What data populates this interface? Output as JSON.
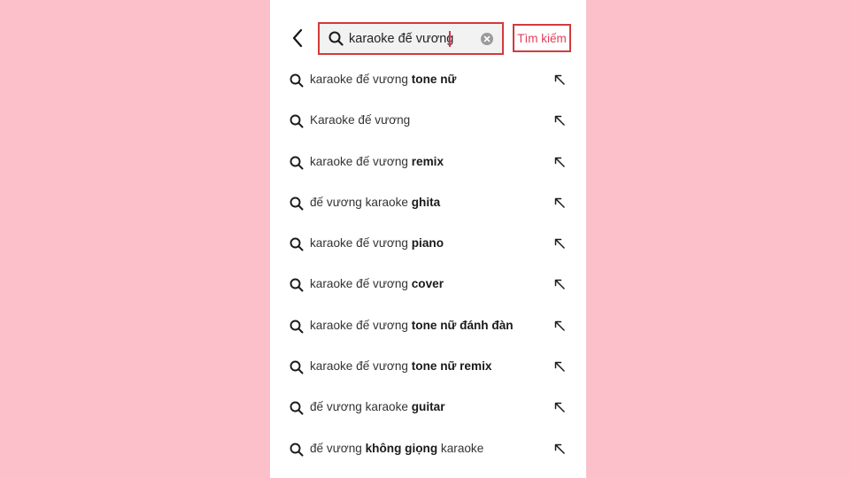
{
  "search": {
    "query": "karaoke đế vương",
    "action_label": "Tìm kiếm"
  },
  "suggestions": [
    {
      "parts": [
        {
          "text": "karaoke đế vương ",
          "bold": false
        },
        {
          "text": "tone nữ",
          "bold": true
        }
      ]
    },
    {
      "parts": [
        {
          "text": "Karaoke đế vương",
          "bold": false
        }
      ]
    },
    {
      "parts": [
        {
          "text": "karaoke đế vương ",
          "bold": false
        },
        {
          "text": "remix",
          "bold": true
        }
      ]
    },
    {
      "parts": [
        {
          "text": "đế vương karaoke ",
          "bold": false
        },
        {
          "text": "ghita",
          "bold": true
        }
      ]
    },
    {
      "parts": [
        {
          "text": "karaoke đế vương ",
          "bold": false
        },
        {
          "text": "piano",
          "bold": true
        }
      ]
    },
    {
      "parts": [
        {
          "text": "karaoke đế vương ",
          "bold": false
        },
        {
          "text": "cover",
          "bold": true
        }
      ]
    },
    {
      "parts": [
        {
          "text": "karaoke đế vương ",
          "bold": false
        },
        {
          "text": "tone nữ đánh đàn",
          "bold": true
        }
      ]
    },
    {
      "parts": [
        {
          "text": "karaoke đế vương ",
          "bold": false
        },
        {
          "text": "tone nữ remix",
          "bold": true
        }
      ]
    },
    {
      "parts": [
        {
          "text": "đế vương karaoke ",
          "bold": false
        },
        {
          "text": "guitar",
          "bold": true
        }
      ]
    },
    {
      "parts": [
        {
          "text": "đế vương ",
          "bold": false
        },
        {
          "text": "không giọng",
          "bold": true
        },
        {
          "text": " karaoke",
          "bold": false
        }
      ]
    }
  ],
  "icons": {
    "back": "chevron-left-icon",
    "search": "search-icon",
    "clear": "clear-circle-icon",
    "fill": "arrow-up-left-icon"
  },
  "colors": {
    "page_background": "#fcc0ca",
    "highlight_border": "#d33a3a",
    "action_text": "#e0405a",
    "caret": "#e0304a"
  }
}
